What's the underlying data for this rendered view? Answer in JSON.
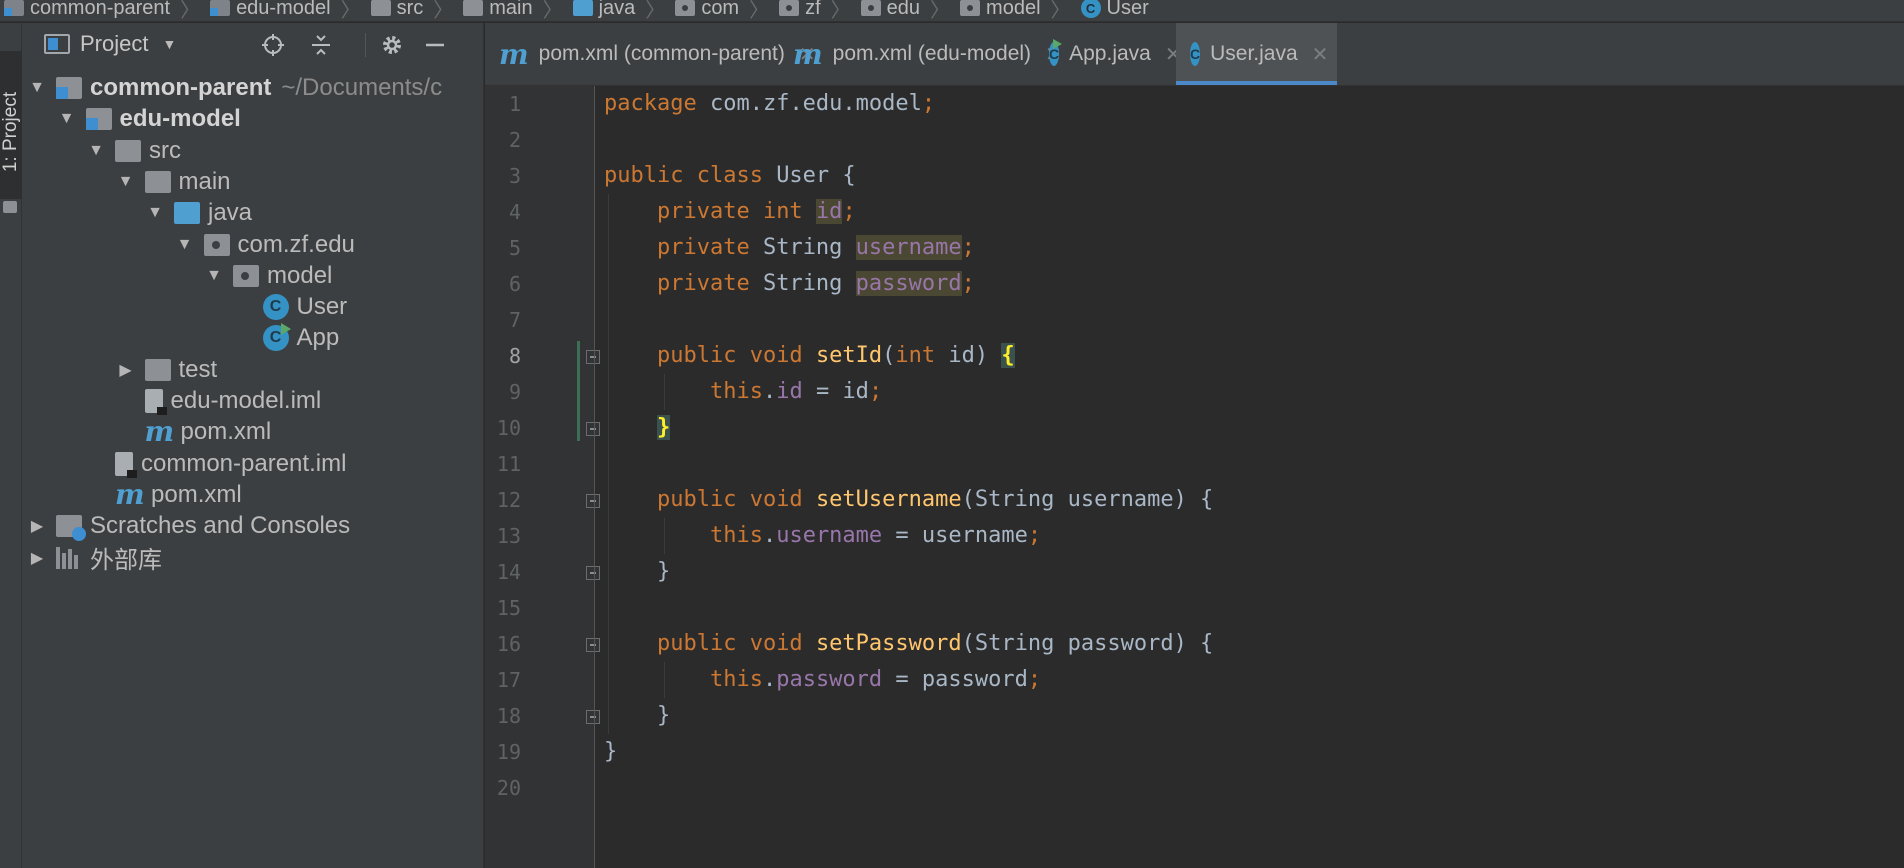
{
  "breadcrumb": [
    {
      "label": "common-parent",
      "icon": "module-icon"
    },
    {
      "label": "edu-model",
      "icon": "module-icon"
    },
    {
      "label": "src",
      "icon": "folder-icon"
    },
    {
      "label": "main",
      "icon": "folder-icon"
    },
    {
      "label": "java",
      "icon": "source-folder-icon"
    },
    {
      "label": "com",
      "icon": "package-icon"
    },
    {
      "label": "zf",
      "icon": "package-icon"
    },
    {
      "label": "edu",
      "icon": "package-icon"
    },
    {
      "label": "model",
      "icon": "package-icon"
    },
    {
      "label": "User",
      "icon": "class-icon"
    }
  ],
  "stripe": {
    "label": "1: Project"
  },
  "project_panel": {
    "title": "Project",
    "tree": [
      {
        "label": "common-parent",
        "path": "~/Documents/c",
        "bold": true,
        "arrow": "▼",
        "icon": "module"
      },
      {
        "label": "edu-model",
        "bold": true,
        "arrow": "▼",
        "icon": "module"
      },
      {
        "label": "src",
        "arrow": "▼",
        "icon": "folder"
      },
      {
        "label": "main",
        "arrow": "▼",
        "icon": "folder"
      },
      {
        "label": "java",
        "arrow": "▼",
        "icon": "folder-blue"
      },
      {
        "label": "com.zf.edu",
        "arrow": "▼",
        "icon": "package"
      },
      {
        "label": "model",
        "arrow": "▼",
        "icon": "package"
      },
      {
        "label": "User",
        "arrow": "",
        "icon": "class"
      },
      {
        "label": "App",
        "arrow": "",
        "icon": "runclass"
      },
      {
        "label": "test",
        "arrow": "▶",
        "icon": "folder"
      },
      {
        "label": "edu-model.iml",
        "arrow": "",
        "icon": "file"
      },
      {
        "label": "pom.xml",
        "arrow": "",
        "icon": "maven"
      },
      {
        "label": "common-parent.iml",
        "arrow": "",
        "icon": "file"
      },
      {
        "label": "pom.xml",
        "arrow": "",
        "icon": "maven"
      },
      {
        "label": "Scratches and Consoles",
        "arrow": "▶",
        "icon": "scratch"
      },
      {
        "label": "外部库",
        "arrow": "▶",
        "icon": "library"
      }
    ]
  },
  "tabs": [
    {
      "label": "pom.xml (common-parent)",
      "icon": "maven",
      "active": false
    },
    {
      "label": "pom.xml (edu-model)",
      "icon": "maven",
      "active": false
    },
    {
      "label": "App.java",
      "icon": "runclass",
      "active": false
    },
    {
      "label": "User.java",
      "icon": "class",
      "active": true
    }
  ],
  "editor": {
    "current_line": 8,
    "line_numbers": [
      "1",
      "2",
      "3",
      "4",
      "5",
      "6",
      "7",
      "8",
      "9",
      "10",
      "11",
      "12",
      "13",
      "14",
      "15",
      "16",
      "17",
      "18",
      "19",
      "20"
    ],
    "lines": [
      [
        [
          "kw",
          "package "
        ],
        [
          "cls",
          "com.zf.edu.model"
        ],
        [
          "pun",
          ";"
        ]
      ],
      [],
      [
        [
          "kw",
          "public class "
        ],
        [
          "cls",
          "User "
        ],
        [
          "cls",
          "{"
        ]
      ],
      [
        [
          "cls",
          "    "
        ],
        [
          "kw",
          "private int "
        ],
        [
          "hl",
          "id"
        ],
        [
          "pun",
          ";"
        ]
      ],
      [
        [
          "cls",
          "    "
        ],
        [
          "kw",
          "private "
        ],
        [
          "cls",
          "String "
        ],
        [
          "hl",
          "username"
        ],
        [
          "pun",
          ";"
        ]
      ],
      [
        [
          "cls",
          "    "
        ],
        [
          "kw",
          "private "
        ],
        [
          "cls",
          "String "
        ],
        [
          "hl",
          "password"
        ],
        [
          "pun",
          ";"
        ]
      ],
      [],
      [
        [
          "cls",
          "    "
        ],
        [
          "kw",
          "public void "
        ],
        [
          "mtd",
          "setId"
        ],
        [
          "cls",
          "("
        ],
        [
          "kw",
          "int "
        ],
        [
          "cls",
          "id) "
        ],
        [
          "brace-hl",
          "{"
        ]
      ],
      [
        [
          "cls",
          "        "
        ],
        [
          "kw",
          "this"
        ],
        [
          "cls",
          "."
        ],
        [
          "fld",
          "id"
        ],
        [
          "cls",
          " = id"
        ],
        [
          "pun",
          ";"
        ]
      ],
      [
        [
          "cls",
          "    "
        ],
        [
          "brace-hl",
          "}"
        ]
      ],
      [],
      [
        [
          "cls",
          "    "
        ],
        [
          "kw",
          "public void "
        ],
        [
          "mtd",
          "setUsername"
        ],
        [
          "cls",
          "(String username) {"
        ]
      ],
      [
        [
          "cls",
          "        "
        ],
        [
          "kw",
          "this"
        ],
        [
          "cls",
          "."
        ],
        [
          "fld",
          "username"
        ],
        [
          "cls",
          " = username"
        ],
        [
          "pun",
          ";"
        ]
      ],
      [
        [
          "cls",
          "    }"
        ]
      ],
      [],
      [
        [
          "cls",
          "    "
        ],
        [
          "kw",
          "public void "
        ],
        [
          "mtd",
          "setPassword"
        ],
        [
          "cls",
          "(String password) {"
        ]
      ],
      [
        [
          "cls",
          "        "
        ],
        [
          "kw",
          "this"
        ],
        [
          "cls",
          "."
        ],
        [
          "fld",
          "password"
        ],
        [
          "cls",
          " = password"
        ],
        [
          "pun",
          ";"
        ]
      ],
      [
        [
          "cls",
          "    }"
        ]
      ],
      [
        [
          "cls",
          "}"
        ]
      ],
      []
    ]
  }
}
